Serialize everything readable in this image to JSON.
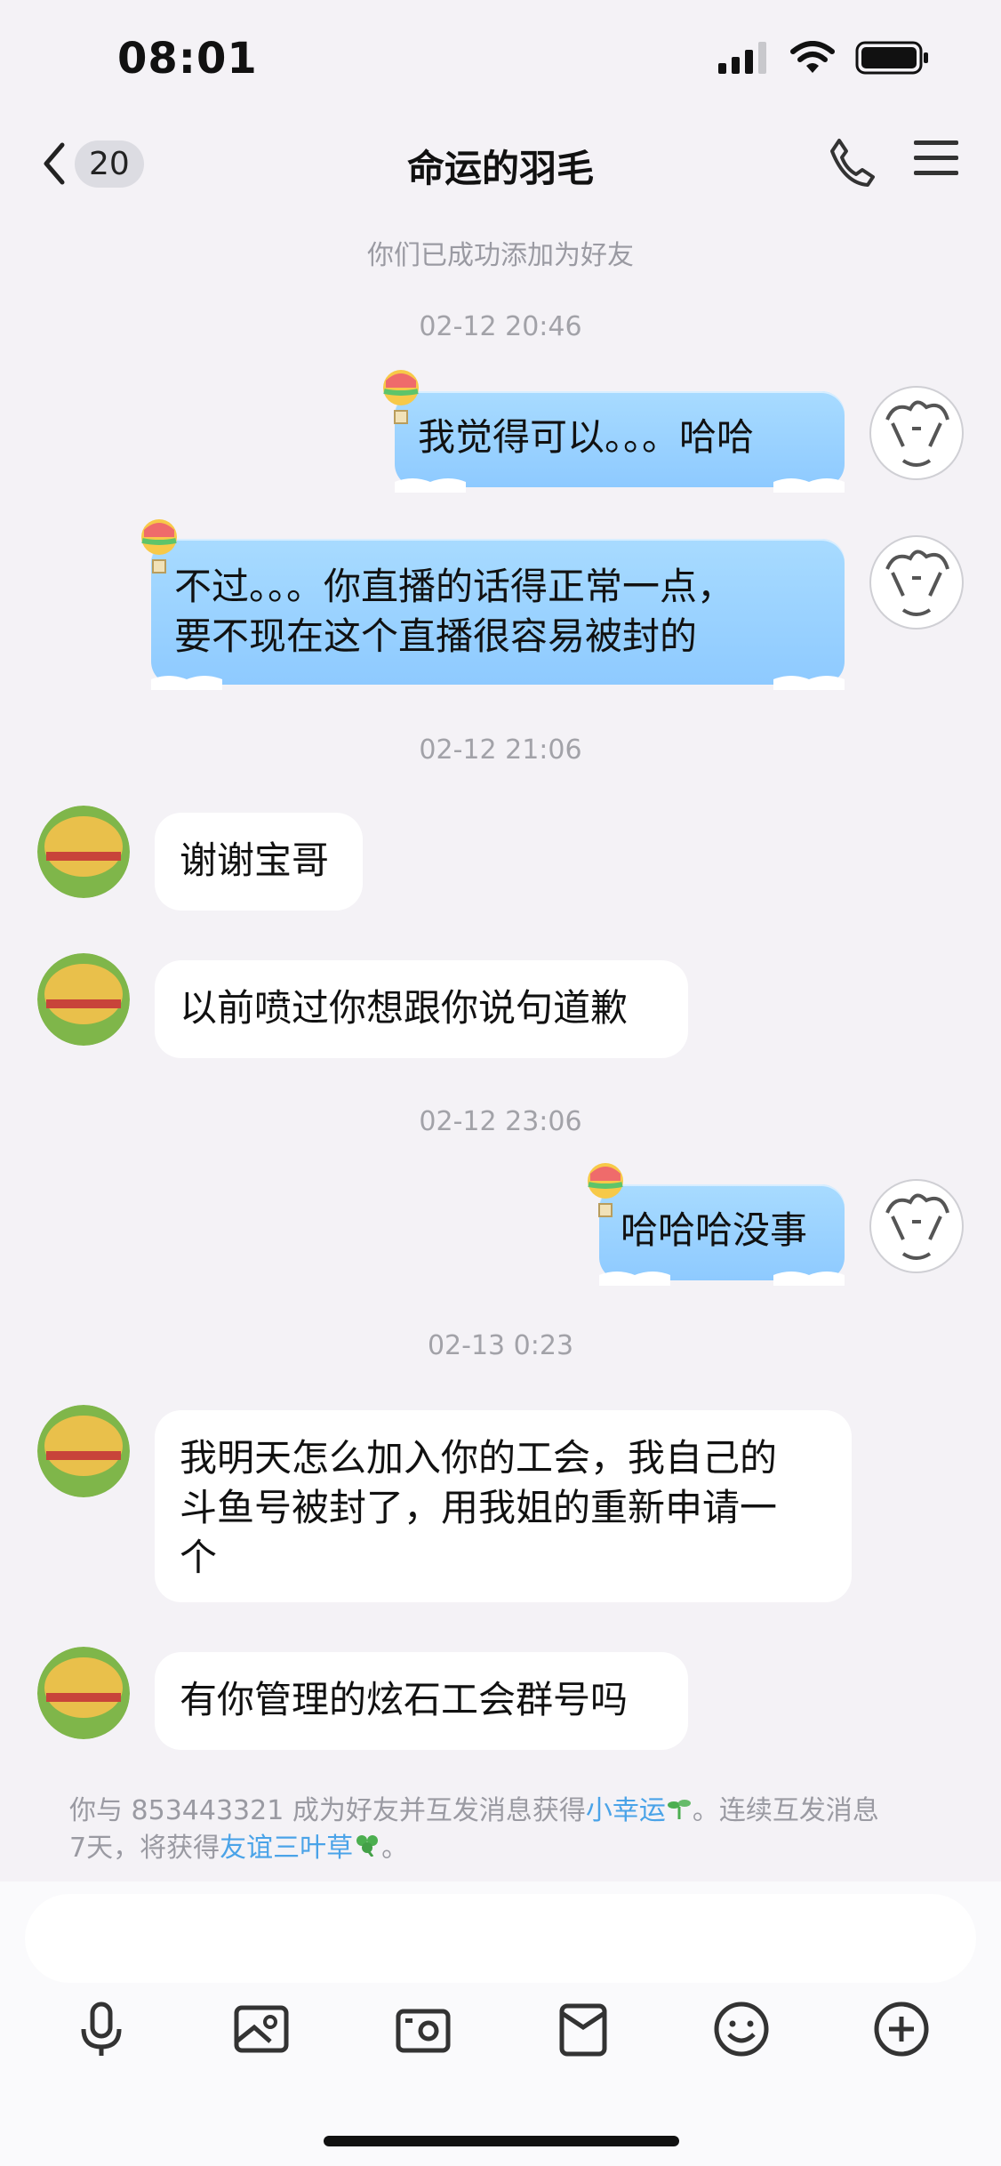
{
  "status": {
    "time": "08:01"
  },
  "nav": {
    "unread": "20",
    "title": "命运的羽毛"
  },
  "system_message": "你们已成功添加为好友",
  "timestamps": [
    "02-12 20:46",
    "02-12 21:06",
    "02-12 23:06",
    "02-13 0:23"
  ],
  "messages": {
    "m1": "我觉得可以。。。哈哈",
    "m2_line1": "不过。。。你直播的话得正常一点，",
    "m2_line2": "要不现在这个直播很容易被封的",
    "m3": "谢谢宝哥",
    "m4": "以前喷过你想跟你说句道歉",
    "m5": "哈哈哈没事",
    "m6_line1": "我明天怎么加入你的工会，我自己的",
    "m6_line2": "斗鱼号被封了，用我姐的重新申请一",
    "m6_line3": "个",
    "m7": "有你管理的炫石工会群号吗"
  },
  "notice": {
    "part1": "你与 853443321 成为好友并互发消息获得",
    "link1": "小幸运",
    "part2": "。连续互发消息",
    "part3": "7天，将获得",
    "link2": "友谊三叶草",
    "part4": "。"
  },
  "toolbar_icons": [
    "microphone-icon",
    "image-icon",
    "camera-icon",
    "red-packet-icon",
    "emoji-icon",
    "plus-icon"
  ]
}
